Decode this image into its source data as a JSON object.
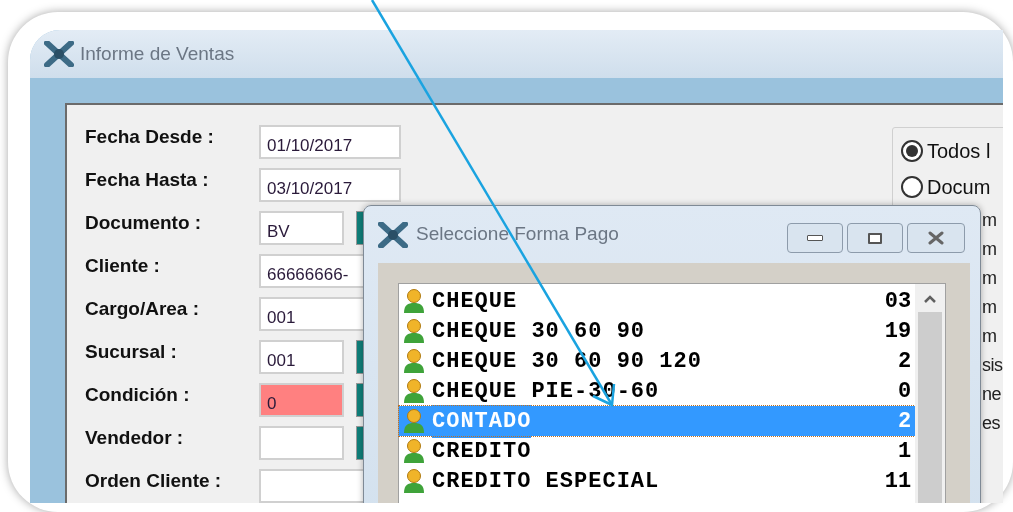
{
  "window": {
    "title": "Informe de Ventas"
  },
  "form": {
    "fields": [
      {
        "label": "Fecha Desde :",
        "value": "01/10/2017",
        "kind": "date",
        "error": false
      },
      {
        "label": "Fecha Hasta :",
        "value": "03/10/2017",
        "kind": "date",
        "error": false
      },
      {
        "label": "Documento :",
        "value": "BV",
        "kind": "lookup",
        "error": false
      },
      {
        "label": "Cliente :",
        "value": "66666666-",
        "kind": "wide",
        "error": false
      },
      {
        "label": "Cargo/Area :",
        "value": "001",
        "kind": "wide",
        "error": false
      },
      {
        "label": "Sucursal :",
        "value": "001",
        "kind": "lookup",
        "error": false
      },
      {
        "label": "Condición :",
        "value": "0",
        "kind": "lookup",
        "error": true
      },
      {
        "label": "Vendedor :",
        "kind": "lookup",
        "error": false
      },
      {
        "label": "Orden Cliente :",
        "kind": "wide",
        "error": false
      }
    ]
  },
  "filter": {
    "options": [
      {
        "label": "Todos l",
        "selected": true
      },
      {
        "label": "Docum",
        "selected": false
      }
    ],
    "column_fragments": [
      "m",
      "m",
      "m",
      "m",
      "m",
      "sis",
      "ne",
      "es"
    ]
  },
  "dialog": {
    "title": "Seleccione Forma Pago",
    "items": [
      {
        "name": "CHEQUE",
        "code": "03",
        "selected": false
      },
      {
        "name": "CHEQUE 30 60 90",
        "code": "19",
        "selected": false
      },
      {
        "name": "CHEQUE 30 60 90 120",
        "code": "2",
        "selected": false
      },
      {
        "name": "CHEQUE PIE-30-60",
        "code": "0",
        "selected": false
      },
      {
        "name": "CONTADO",
        "code": "2",
        "selected": true
      },
      {
        "name": "CREDITO",
        "code": "1",
        "selected": false
      },
      {
        "name": "CREDITO ESPECIAL",
        "code": "11",
        "selected": false
      }
    ]
  }
}
